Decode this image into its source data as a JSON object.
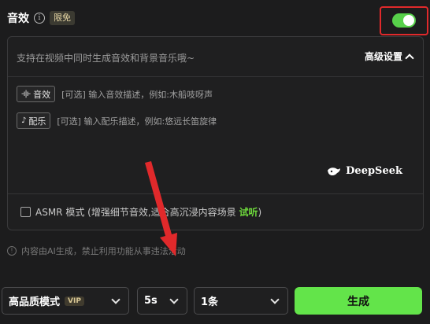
{
  "header": {
    "title": "音效",
    "info_icon_glyph": "i",
    "free_badge": "限免",
    "toggle_on": true
  },
  "panel": {
    "main_placeholder": "支持在视频中同时生成音效和背景音乐哦~",
    "advanced_label": "高级设置",
    "sound_effect": {
      "chip_icon": "-ı|ı-",
      "chip_label": "音效",
      "hint": "[可选] 输入音效描述，例如:木船吱呀声"
    },
    "music": {
      "chip_icon": "♪",
      "chip_label": "配乐",
      "hint": "[可选] 输入配乐描述，例如:悠远长笛旋律"
    },
    "brand": "DeepSeek",
    "asmr": {
      "label": "ASMR 模式 (增强细节音效,适合高沉浸内容场景",
      "listen": "试听",
      "closing": ")",
      "checked": false
    }
  },
  "disclaimer": {
    "icon_glyph": "!",
    "text": "内容由AI生成，禁止利用功能从事违法活动"
  },
  "bottom_bar": {
    "quality": "高品质模式",
    "vip_badge": "VIP",
    "duration": "5s",
    "count": "1条",
    "generate": "生成"
  },
  "colors": {
    "accent_green": "#63e44a",
    "highlight_red": "#e0292b",
    "background": "#1c1c1d"
  }
}
